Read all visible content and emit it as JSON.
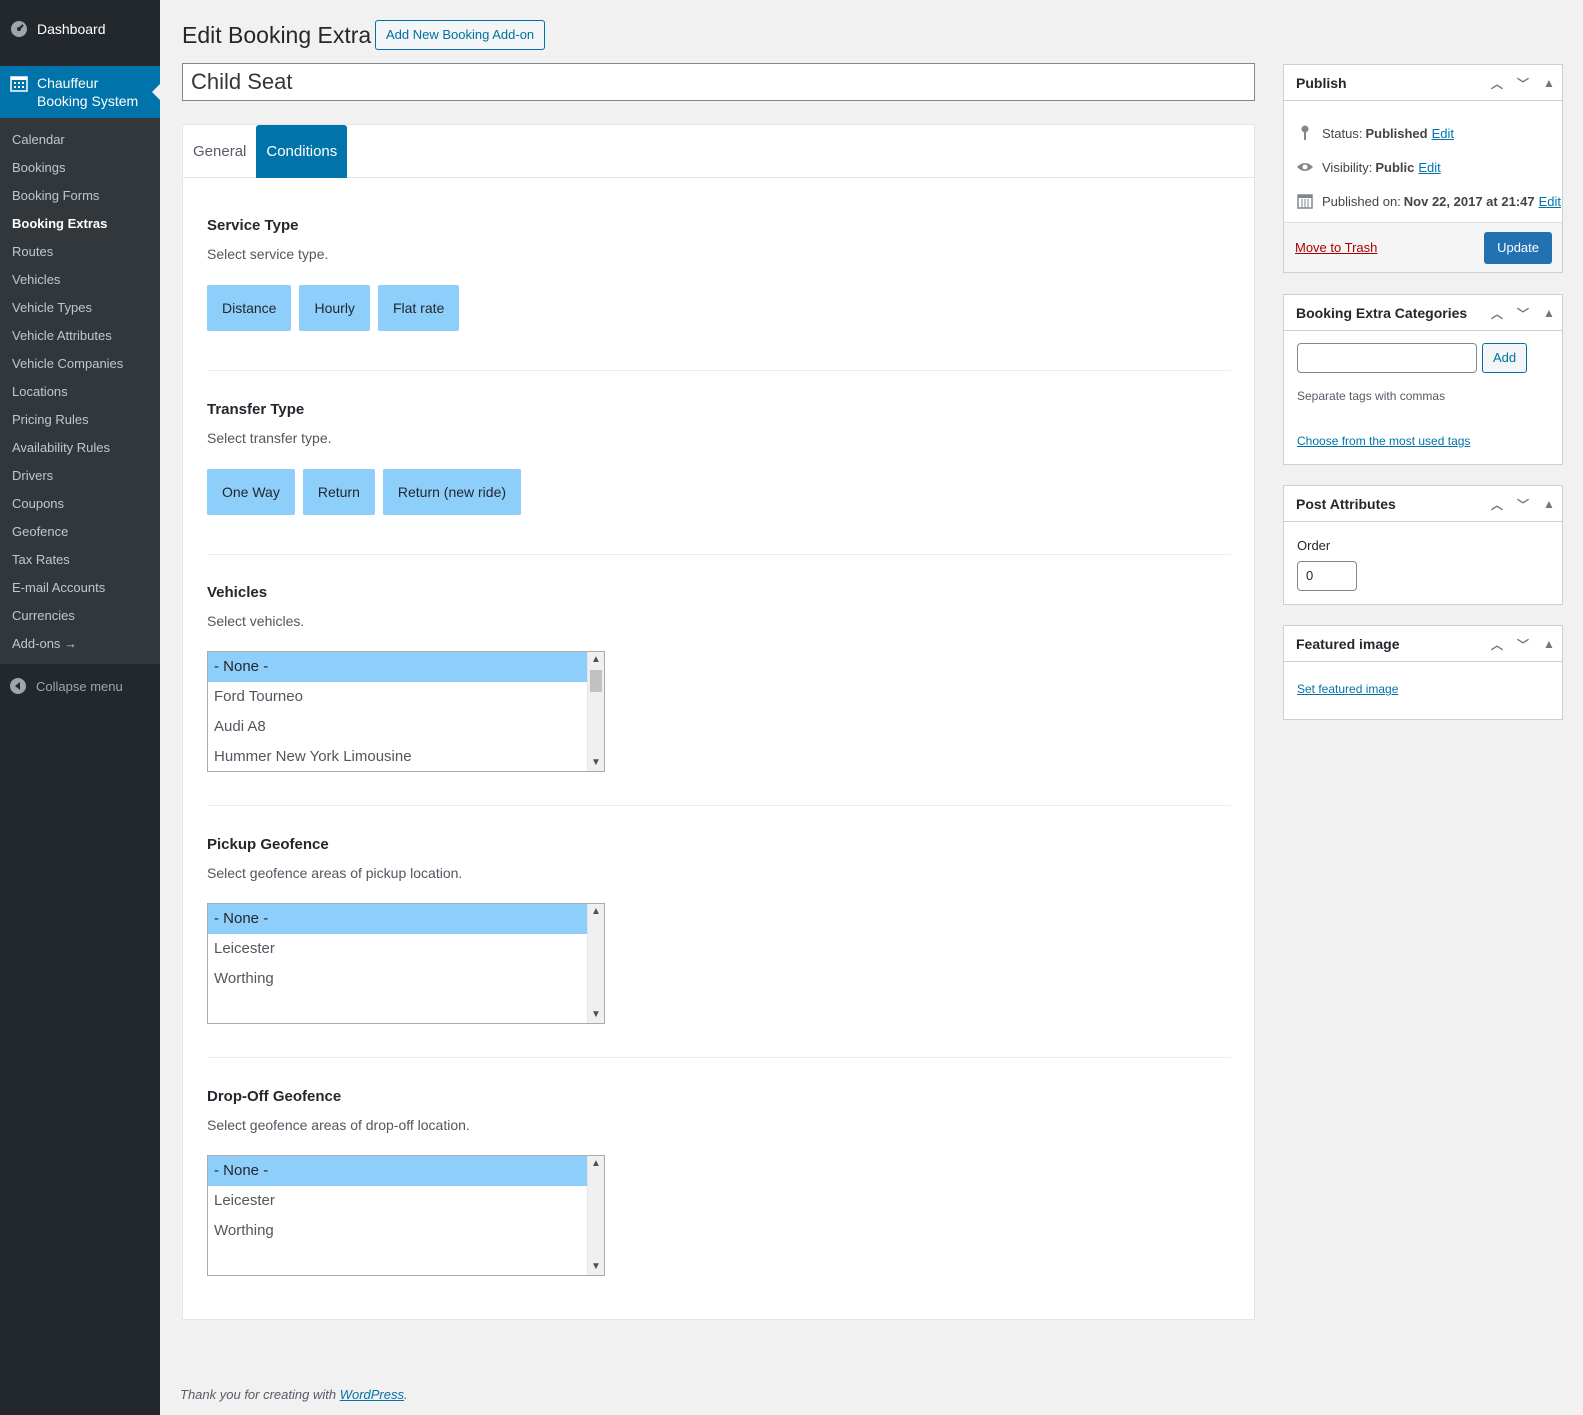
{
  "sidebar": {
    "dashboard_label": "Dashboard",
    "active_label_line1": "Chauffeur",
    "active_label_line2": "Booking System",
    "items": [
      {
        "label": "Calendar"
      },
      {
        "label": "Bookings"
      },
      {
        "label": "Booking Forms"
      },
      {
        "label": "Booking Extras"
      },
      {
        "label": "Routes"
      },
      {
        "label": "Vehicles"
      },
      {
        "label": "Vehicle Types"
      },
      {
        "label": "Vehicle Attributes"
      },
      {
        "label": "Vehicle Companies"
      },
      {
        "label": "Locations"
      },
      {
        "label": "Pricing Rules"
      },
      {
        "label": "Availability Rules"
      },
      {
        "label": "Drivers"
      },
      {
        "label": "Coupons"
      },
      {
        "label": "Geofence"
      },
      {
        "label": "Tax Rates"
      },
      {
        "label": "E-mail Accounts"
      },
      {
        "label": "Currencies"
      },
      {
        "label": "Add-ons →"
      }
    ],
    "current_item": "Booking Extras",
    "collapse_label": "Collapse menu"
  },
  "header": {
    "title": "Edit Booking Extra",
    "add_new_label": "Add New Booking Add-on",
    "post_title_value": "Child Seat"
  },
  "tabs": [
    {
      "label": "General",
      "active": false
    },
    {
      "label": "Conditions",
      "active": true
    }
  ],
  "conditions": {
    "service_type": {
      "title": "Service Type",
      "description": "Select service type.",
      "options": [
        "Distance",
        "Hourly",
        "Flat rate"
      ]
    },
    "transfer_type": {
      "title": "Transfer Type",
      "description": "Select transfer type.",
      "options": [
        "One Way",
        "Return",
        "Return (new ride)"
      ]
    },
    "vehicles": {
      "title": "Vehicles",
      "description": "Select vehicles.",
      "options": [
        "- None -",
        "Ford Tourneo",
        "Audi A8",
        "Hummer New York Limousine"
      ],
      "selected": "- None -"
    },
    "pickup_geofence": {
      "title": "Pickup Geofence",
      "description": "Select geofence areas of pickup location.",
      "options": [
        "- None -",
        "Leicester",
        "Worthing"
      ],
      "selected": "- None -"
    },
    "dropoff_geofence": {
      "title": "Drop-Off Geofence",
      "description": "Select geofence areas of drop-off location.",
      "options": [
        "- None -",
        "Leicester",
        "Worthing"
      ],
      "selected": "- None -"
    }
  },
  "publish_box": {
    "title": "Publish",
    "status_label": "Status:",
    "status_value": "Published",
    "visibility_label": "Visibility:",
    "visibility_value": "Public",
    "published_label": "Published on:",
    "published_value": "Nov 22, 2017 at 21:47",
    "edit_label": "Edit",
    "trash_label": "Move to Trash",
    "update_label": "Update"
  },
  "categories_box": {
    "title": "Booking Extra Categories",
    "input_value": "",
    "add_label": "Add",
    "help_text": "Separate tags with commas",
    "choose_link": "Choose from the most used tags"
  },
  "attributes_box": {
    "title": "Post Attributes",
    "order_label": "Order",
    "order_value": "0"
  },
  "featured_box": {
    "title": "Featured image",
    "set_link": "Set featured image"
  },
  "footer": {
    "text": "Thank you for creating with",
    "link": "WordPress",
    "suffix": "."
  },
  "colors": {
    "sidebar_bg": "#23282d",
    "active_menu": "#0073aa",
    "option_chip": "#8ecefb",
    "update_button": "#2271b1"
  }
}
